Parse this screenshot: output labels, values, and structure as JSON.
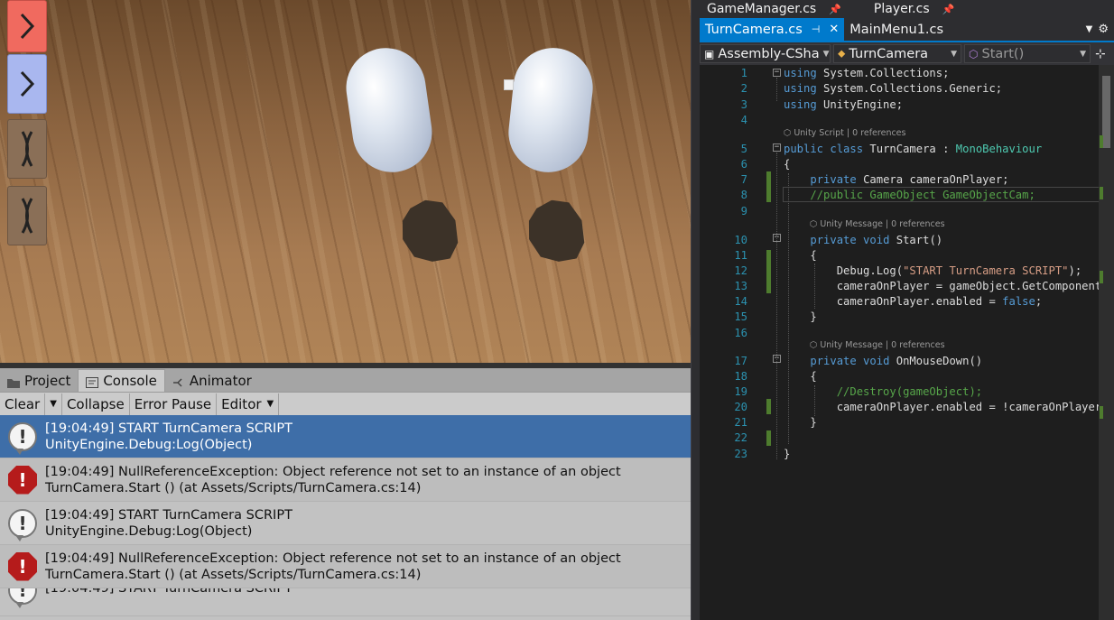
{
  "game_view": {
    "buttons": [
      {
        "icon": "chevron-right",
        "color": "#f06a5f"
      },
      {
        "icon": "chevron-right",
        "color": "#a9b7ef"
      },
      {
        "icon": "x-mark",
        "color": "#8a6f57"
      },
      {
        "icon": "x-mark",
        "color": "#8a6f57"
      }
    ]
  },
  "console": {
    "tabs": [
      {
        "label": "Project",
        "icon": "folder-icon"
      },
      {
        "label": "Console",
        "icon": "console-icon",
        "active": true
      },
      {
        "label": "Animator",
        "icon": "animator-icon"
      }
    ],
    "toolbar": {
      "clear": "Clear",
      "collapse": "Collapse",
      "error_pause": "Error Pause",
      "editor": "Editor"
    },
    "entries": [
      {
        "type": "log",
        "line1": "[19:04:49] START TurnCamera SCRIPT",
        "line2": "UnityEngine.Debug:Log(Object)",
        "selected": true
      },
      {
        "type": "error",
        "line1": "[19:04:49] NullReferenceException: Object reference not set to an instance of an object",
        "line2": "TurnCamera.Start () (at Assets/Scripts/TurnCamera.cs:14)"
      },
      {
        "type": "log",
        "line1": "[19:04:49] START TurnCamera SCRIPT",
        "line2": "UnityEngine.Debug:Log(Object)"
      },
      {
        "type": "error",
        "line1": "[19:04:49] NullReferenceException: Object reference not set to an instance of an object",
        "line2": "TurnCamera.Start () (at Assets/Scripts/TurnCamera.cs:14)"
      },
      {
        "type": "log",
        "line1": "[19:04:49] START TurnCamera SCRIPT",
        "line2": ""
      }
    ]
  },
  "editor": {
    "file_tabs": [
      "GameManager.cs",
      "Player.cs"
    ],
    "doc_tabs": [
      {
        "label": "TurnCamera.cs",
        "active": true
      },
      {
        "label": "MainMenu1.cs"
      }
    ],
    "nav": {
      "project": "Assembly-CSha",
      "class": "TurnCamera",
      "member": "Start()"
    },
    "lens": {
      "class": "Unity Script | 0 references",
      "start": "Unity Message | 0 references",
      "mousedown": "Unity Message | 0 references"
    },
    "line_numbers": [
      "1",
      "2",
      "3",
      "4",
      "5",
      "6",
      "7",
      "8",
      "9",
      "10",
      "11",
      "12",
      "13",
      "14",
      "15",
      "16",
      "17",
      "18",
      "19",
      "20",
      "21",
      "22",
      "23"
    ],
    "code": [
      [
        [
          "kw",
          "using"
        ],
        [
          "",
          "System.Collections;"
        ]
      ],
      [
        [
          "kw",
          "using"
        ],
        [
          "",
          "System.Collections.Generic;"
        ]
      ],
      [
        [
          "kw",
          "using"
        ],
        [
          "",
          "UnityEngine;"
        ]
      ],
      [],
      [
        [
          "kw",
          "public class"
        ],
        [
          "",
          "TurnCamera"
        ],
        [
          "",
          ":"
        ],
        [
          "ty",
          "MonoBehaviour"
        ]
      ],
      [
        [
          "",
          "{"
        ]
      ],
      [
        [
          "",
          "    "
        ],
        [
          "kw",
          "private"
        ],
        [
          "",
          "Camera"
        ],
        [
          "",
          "cameraOnPlayer;"
        ]
      ],
      [
        [
          "cm",
          "    //public GameObject GameObjectCam;"
        ]
      ],
      [],
      [
        [
          "",
          "    "
        ],
        [
          "kw",
          "private void"
        ],
        [
          "",
          "Start()"
        ]
      ],
      [
        [
          "",
          "    {"
        ]
      ],
      [
        [
          "",
          "        Debug.Log("
        ],
        [
          "st",
          "\"START TurnCamera SCRIPT\""
        ],
        [
          "",
          ");"
        ]
      ],
      [
        [
          "",
          "        cameraOnPlayer = gameObject.GetComponent<Camera>();"
        ]
      ],
      [
        [
          "",
          "        cameraOnPlayer.enabled = "
        ],
        [
          "kw",
          "false"
        ],
        [
          "",
          ";"
        ]
      ],
      [
        [
          "",
          "    }"
        ]
      ],
      [],
      [
        [
          "",
          "    "
        ],
        [
          "kw",
          "private void"
        ],
        [
          "",
          "OnMouseDown()"
        ]
      ],
      [
        [
          "",
          "    {"
        ]
      ],
      [
        [
          "cm",
          "        //Destroy(gameObject);"
        ]
      ],
      [
        [
          "",
          "        cameraOnPlayer.enabled = !cameraOnPlayer.enabled;"
        ]
      ],
      [
        [
          "",
          "    }"
        ]
      ],
      [],
      [
        [
          "",
          "}"
        ]
      ]
    ],
    "colors": {
      "keyword": "#569cd6",
      "type": "#4ec9b0",
      "string": "#d69d85",
      "comment": "#57a64a",
      "line_number": "#2b91af",
      "accent": "#007acc"
    }
  }
}
